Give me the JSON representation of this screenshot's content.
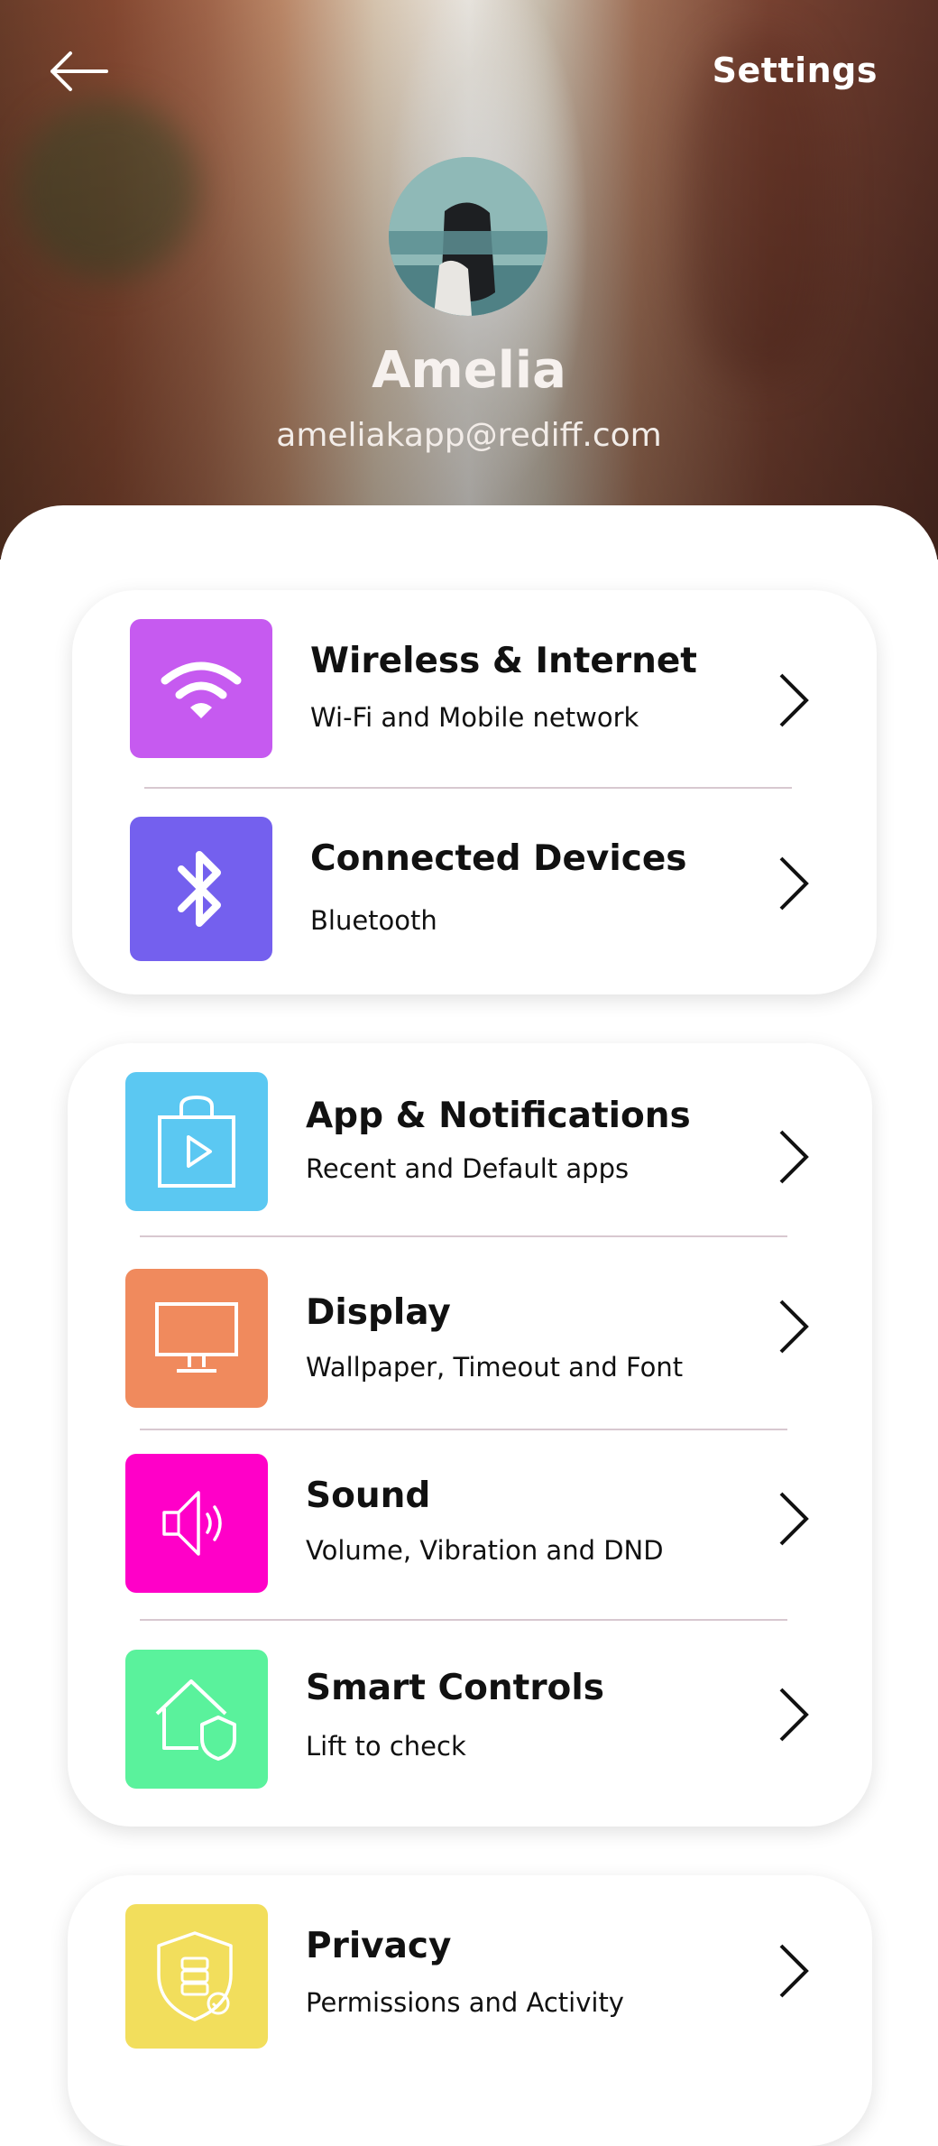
{
  "header": {
    "title": "Settings",
    "back_icon": "arrow-left-icon"
  },
  "profile": {
    "name": "Amelia",
    "email": "ameliakapp@rediff.com"
  },
  "colors": {
    "wireless": "#C65AF0",
    "bluetooth": "#7460EE",
    "apps": "#5BC8F2",
    "display": "#F08A5D",
    "sound": "#FF00C8",
    "smart": "#5AF29C",
    "privacy": "#F2DE5C"
  },
  "groups": [
    {
      "items": [
        {
          "title": "Wireless & Internet",
          "subtitle": "Wi-Fi and Mobile network",
          "icon": "wifi-icon"
        },
        {
          "title": "Connected Devices",
          "subtitle": "Bluetooth",
          "icon": "bluetooth-icon"
        }
      ]
    },
    {
      "items": [
        {
          "title": "App & Notifications",
          "subtitle": "Recent and Default apps",
          "icon": "shopping-bag-play-icon"
        },
        {
          "title": "Display",
          "subtitle": "Wallpaper, Timeout and Font",
          "icon": "monitor-icon"
        },
        {
          "title": "Sound",
          "subtitle": "Volume, Vibration and DND",
          "icon": "speaker-icon"
        },
        {
          "title": "Smart Controls",
          "subtitle": "Lift to check",
          "icon": "home-shield-icon"
        }
      ]
    },
    {
      "items": [
        {
          "title": "Privacy",
          "subtitle": "Permissions and Activity",
          "icon": "shield-check-icon"
        }
      ]
    }
  ]
}
